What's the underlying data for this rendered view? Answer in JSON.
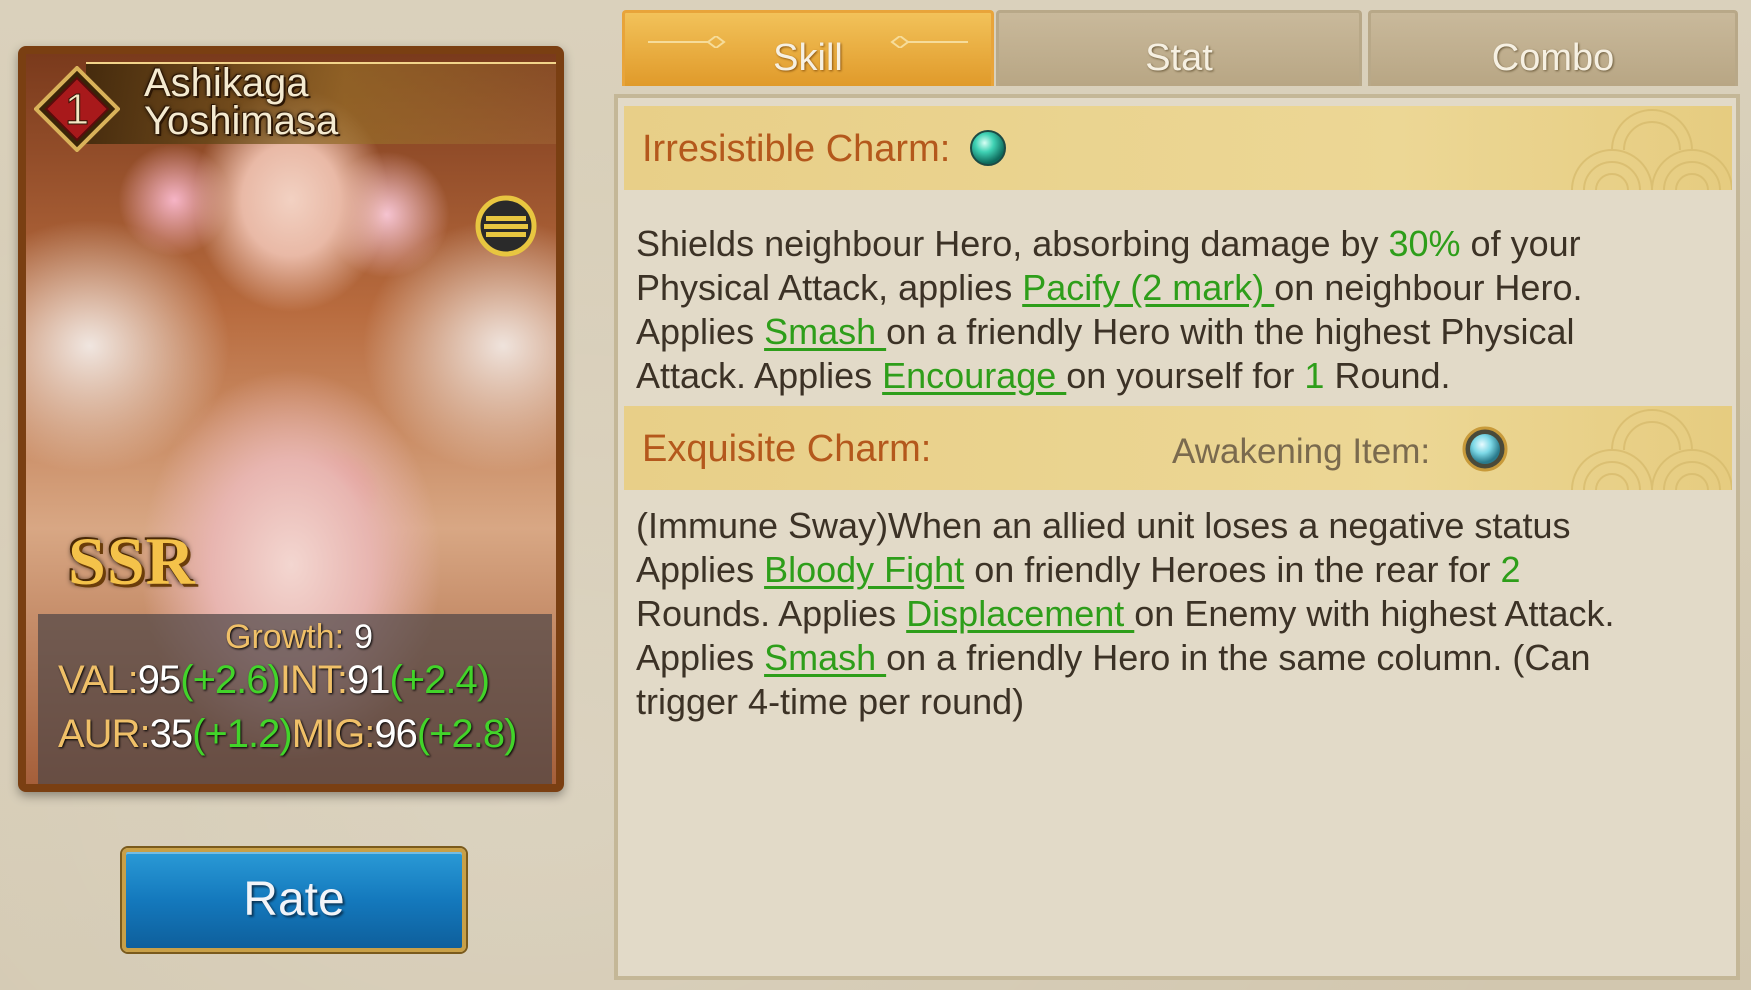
{
  "hero": {
    "rank": "1",
    "name_line1": "Ashikaga",
    "name_line2": "Yoshimasa",
    "rarity": "SSR",
    "growth_label": "Growth:",
    "growth_value": "9",
    "stats": {
      "val_label": "VAL:",
      "val": "95",
      "val_bonus": "(+2.6)",
      "int_label": "INT:",
      "int": "91",
      "int_bonus": "(+2.4)",
      "aur_label": "AUR:",
      "aur": "35",
      "aur_bonus": "(+1.2)",
      "mig_label": "MIG:",
      "mig": "96",
      "mig_bonus": "(+2.8)"
    }
  },
  "rate_button": "Rate",
  "tabs": [
    {
      "label": "Skill",
      "active": true
    },
    {
      "label": "Stat",
      "active": false
    },
    {
      "label": "Combo",
      "active": false
    }
  ],
  "skills": {
    "skill1": {
      "name": "Irresistible Charm:",
      "line1_a": "Shields  neighbour Hero, absorbing damage by ",
      "line1_pct": "30%",
      "line1_b": " of your",
      "line2_a": "Physical  Attack, applies ",
      "line2_link": "Pacify  (2 mark) ",
      "line2_b": "on  neighbour Hero.",
      "line3_a": "Applies ",
      "line3_link": "Smash ",
      "line3_b": "on a friendly Hero with the highest Physical",
      "line4_a": "Attack. Applies ",
      "line4_link": "Encourage ",
      "line4_b": "on yourself for ",
      "line4_num": "1",
      "line4_c": " Round."
    },
    "skill2": {
      "name": "Exquisite Charm:",
      "awakening_label": "Awakening Item:",
      "line1": "(Immune Sway)When an allied unit loses a negative status",
      "line2_a": "Applies ",
      "line2_link": "Bloody Fight",
      "line2_b": " on friendly Heroes in the rear for ",
      "line2_num": "2",
      "line3_a": "Rounds. Applies ",
      "line3_link": "Displacement ",
      "line3_b": "on Enemy with highest Attack.",
      "line4_a": "Applies ",
      "line4_link": "Smash ",
      "line4_b": "on  a friendly Hero in the same column. (Can",
      "line5": "trigger 4-time per round)"
    }
  },
  "icons": {
    "rank": "rank-diamond-icon",
    "menu": "menu-lines-icon",
    "skill_gem": "teal-gem-icon",
    "awakening_gem": "awakening-gem-icon"
  },
  "colors": {
    "highlight_green": "#2e9e1a",
    "skill_name": "#b4581c",
    "tab_active": "#e09a2a",
    "rate_blue": "#1479bd"
  }
}
